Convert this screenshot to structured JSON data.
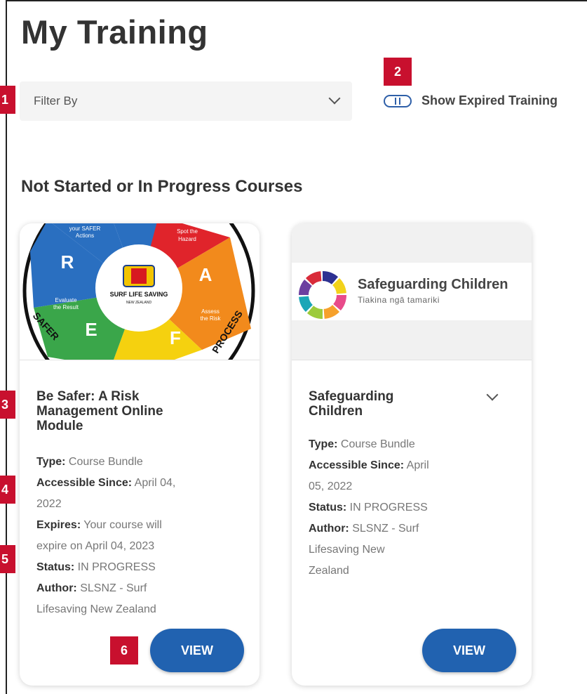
{
  "page": {
    "title": "My Training"
  },
  "filter": {
    "label": "Filter By"
  },
  "toggle": {
    "label": "Show Expired Training"
  },
  "section": {
    "heading": "Not Started or In Progress Courses"
  },
  "courses": [
    {
      "title_lines": [
        "Be Safer: A Risk",
        "Management Online",
        "Module"
      ],
      "image": {
        "caption_top": [
          "your SAFER",
          "Actions"
        ],
        "caption_spot": [
          "Spot the",
          "Hazard"
        ],
        "caption_eval": [
          "Evaluate",
          "the Result"
        ],
        "caption_assess": [
          "Assess",
          "the Risk"
        ],
        "logo_text": "SURF LIFE SAVING",
        "logo_sub": "NEW ZEALAND",
        "letter_r": "R",
        "letter_a": "A",
        "letter_e": "E",
        "letter_f": "F",
        "ring_left": "SAFER",
        "ring_right": "PROCESS"
      },
      "meta": [
        {
          "label": "Type:",
          "value": " Course Bundle"
        },
        {
          "label": "Accessible Since:",
          "value": " April 04,"
        },
        {
          "label": "",
          "value": "2022"
        },
        {
          "label": "Expires:",
          "value": " Your course will"
        },
        {
          "label": "",
          "value": "expire on April 04, 2023"
        },
        {
          "label": "Status:",
          "value": " IN PROGRESS"
        },
        {
          "label": "Author:",
          "value": " SLSNZ - Surf"
        },
        {
          "label": "",
          "value": "Lifesaving New Zealand"
        }
      ],
      "button": "VIEW"
    },
    {
      "title_lines": [
        "Safeguarding",
        "Children"
      ],
      "image": {
        "brand_title": "Safeguarding Children",
        "brand_sub": "Tiakina ngā tamariki",
        "colors": [
          "#e84b8a",
          "#f6a12b",
          "#9ccb3b",
          "#1aa6b7",
          "#6c3fa0",
          "#d92b3a",
          "#2e3192",
          "#f2d21b"
        ]
      },
      "meta": [
        {
          "label": "Type:",
          "value": " Course Bundle"
        },
        {
          "label": "Accessible Since:",
          "value": " April"
        },
        {
          "label": "",
          "value": "05, 2022"
        },
        {
          "label": "Status:",
          "value": " IN PROGRESS"
        },
        {
          "label": "Author:",
          "value": " SLSNZ - Surf"
        },
        {
          "label": "",
          "value": "Lifesaving New"
        },
        {
          "label": "",
          "value": "Zealand"
        }
      ],
      "button": "VIEW"
    }
  ],
  "callouts": [
    "1",
    "2",
    "3",
    "4",
    "5",
    "6"
  ],
  "colors": {
    "primary_button": "#2162b0",
    "callout": "#c8102e",
    "toggle": "#2e5fa8"
  }
}
